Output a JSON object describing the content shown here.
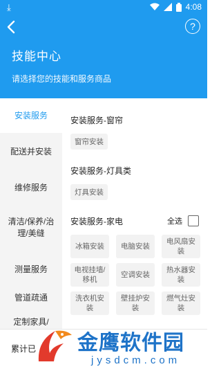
{
  "status_bar": {
    "time": "4:08"
  },
  "header": {
    "title": "技能中心",
    "subtitle": "请选择您的技能和服务商品",
    "help_label": "?"
  },
  "sidebar": {
    "items": [
      {
        "label": "安装服务",
        "active": true
      },
      {
        "label": "配送并安装"
      },
      {
        "label": "维修服务"
      },
      {
        "label": "清洁/保养/治理/美缝"
      },
      {
        "label": "测量服务"
      },
      {
        "label": "管道疏通"
      },
      {
        "label": "定制家具/门"
      }
    ]
  },
  "sections": [
    {
      "title": "安装服务-窗帘",
      "tags": [
        "窗帘安装"
      ]
    },
    {
      "title": "安装服务-灯具类",
      "tags": [
        "灯具安装"
      ]
    },
    {
      "title": "安装服务-家电",
      "select_all_label": "全选",
      "tags": [
        "冰箱安装",
        "电脑安装",
        "电风扇安装",
        "电视挂墙/移机",
        "空调安装",
        "热水器安装",
        "洗衣机安装",
        "壁挂炉安装",
        "燃气灶安装"
      ]
    }
  ],
  "footer": {
    "label": "累计已"
  },
  "watermark": {
    "title": "金鹰软件园",
    "url": "jysdcm.com"
  },
  "colors": {
    "primary": "#1f9bef",
    "watermark": "#1e73c8",
    "logo_red": "#e23a2c"
  }
}
